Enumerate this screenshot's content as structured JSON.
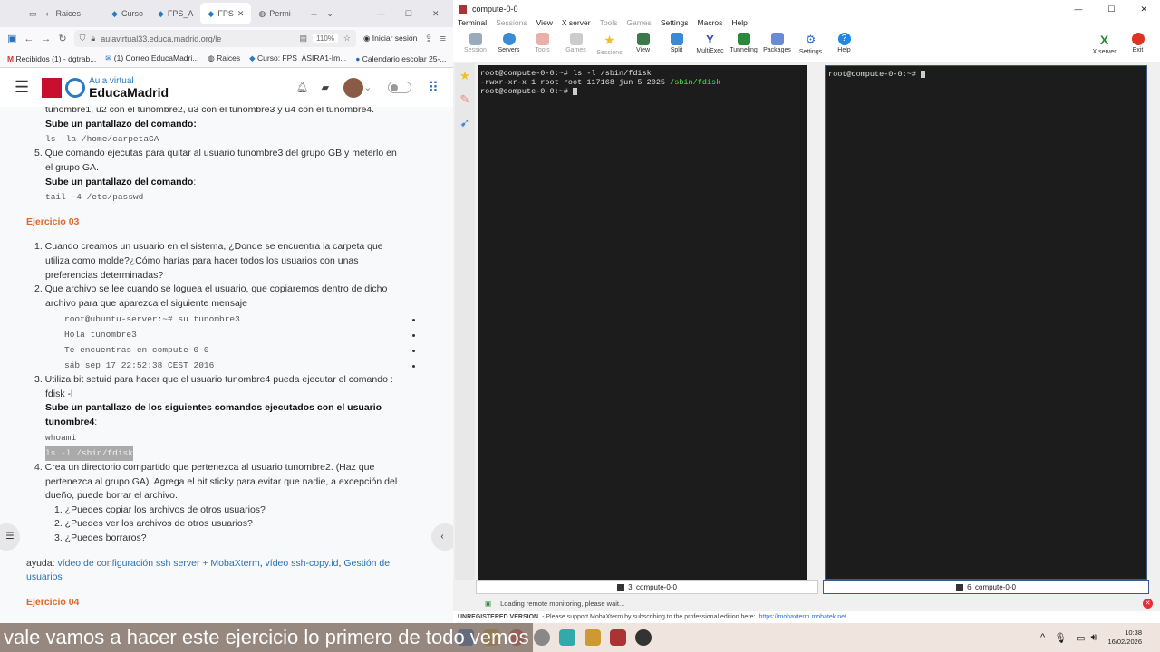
{
  "browser": {
    "tabs": [
      {
        "label": "Raices"
      },
      {
        "label": "Curso"
      },
      {
        "label": "FPS_A"
      },
      {
        "label": "FPS",
        "active": true
      },
      {
        "label": "Permi"
      }
    ],
    "url": "aulavirtual33.educa.madrid.org/le",
    "zoom": "110%",
    "signin": "Iniciar sesión",
    "bookmarks": [
      "Recibidos (1) - dgtrab...",
      "(1) Correo EducaMadri...",
      "Raices",
      "Curso: FPS_ASIRA1-Im...",
      "Calendario escolar 25-..."
    ],
    "site": {
      "brand_top": "Aula virtual",
      "brand_bottom": "EducaMadrid"
    }
  },
  "content": {
    "l1": "tunombre1, u2 con el tunombre2, u3 con el tunombre3 y u4 con el tunombre4.",
    "sube1": "Sube un pantallazo del comando:",
    "cmd1": "ls -la /home/carpetaGA",
    "q5a": "5. Que comando ejecutas para quitar al usuario tunombre3 del grupo GB y meterlo en",
    "q5b": "el grupo GA.",
    "sube2": "Sube un pantallazo del comando",
    "colon": ":",
    "cmd2": "tail -4  /etc/passwd",
    "ej3": "Ejercicio  03",
    "e1a": "1. Cuando creamos un usuario en el sistema, ¿Donde se encuentra la carpeta que",
    "e1b": "utiliza como molde?¿Cómo harías para hacer todos los usuarios con unas",
    "e1c": "preferencias determinadas?",
    "e2a": "2. Que archivo se lee cuando se loguea el usuario, que copiaremos dentro de dicho",
    "e2b": "archivo para que aparezca el siguiente mensaje",
    "msg": [
      "root@ubuntu-server:~# su tunombre3",
      "Hola tunombre3",
      "Te encuentras en compute-0-0",
      "sáb sep 17 22:52:38 CEST 2016"
    ],
    "e3a": "3. Utiliza bit setuid para hacer que el usuario tunombre4 pueda ejecutar el comando :",
    "e3b": "fdisk  -l",
    "sube3a": "Subeun pantallazo de los siguientes comandos ejecutados con el usuario",
    "sube3b": "tunombre4",
    "whoami": "whoami",
    "lsfdisk": "ls -l /sbin/fdisk",
    "e4a": "4. Crea un directorio compartido que pertenezca al usuario tunombre2. (Haz que",
    "e4b": "pertenezca al grupo GA). Agrega el bit sticky para evitar que nadie, a excepción del",
    "e4c": "dueño, puede borrar el archivo.",
    "s1": "1. ¿Puedes copiar los archivos de otros usuarios?",
    "s2": "2. ¿Puedes ver los archivos de otros usuarios?",
    "s3": "3. ¿Puedes borraros?",
    "ayuda": "ayuda:",
    "link1": "vídeo de configuración ssh server + MobaXterm",
    "link2": "vídeo ssh-copy.id",
    "link3a": "Gestión de",
    "link3b": "usuarios",
    "ej4": "Ejercicio  04"
  },
  "moba": {
    "title": "compute-0-0",
    "menu": [
      "Terminal",
      "Sessions",
      "View",
      "X server",
      "Tools",
      "Games",
      "Settings",
      "Macros",
      "Help"
    ],
    "toolbar": [
      "Session",
      "Servers",
      "Tools",
      "Games",
      "Sessions",
      "View",
      "Split",
      "MultiExec",
      "Tunneling",
      "Packages",
      "Settings",
      "Help"
    ],
    "toolbar_right": [
      "X server",
      "Exit"
    ],
    "left_term": {
      "l1": "root@compute-0-0:~# ls -l /sbin/fdisk",
      "l2a": "-rwxr-xr-x 1 root root 117168 jun  5  2025 ",
      "l2b": "/sbin/fdisk",
      "l3": "root@compute-0-0:~# "
    },
    "right_term": {
      "l1": "root@compute-0-0:~# "
    },
    "tab_left": "3. compute-0-0",
    "tab_right": "6. compute-0-0",
    "status": "Loading remote monitoring, please wait...",
    "unreg_label": "UNREGISTERED VERSION",
    "unreg_text": "-  Please support MobaXterm by subscribing to the professional edition here:",
    "unreg_link": "https://mobaxterm.mobatek.net"
  },
  "taskbar": {
    "time": "10:38",
    "date": "16/02/2026"
  },
  "caption": "vale vamos a hacer este ejercicio lo primero de todo vemos"
}
